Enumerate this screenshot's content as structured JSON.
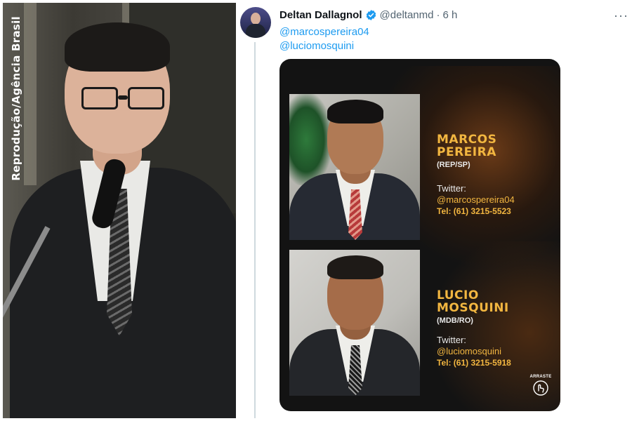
{
  "photo_credit": "Reprodução/Agência Brasil",
  "tweet": {
    "author_name": "Deltan Dallagnol",
    "author_handle": "@deltanmd",
    "separator": "·",
    "time": "6 h",
    "mentions": [
      "@marcospereira04",
      "@luciomosquini"
    ],
    "more_icon": "more-horizontal-icon",
    "verified_icon": "verified-badge-icon",
    "accent_color": "#1d9bf0"
  },
  "card": {
    "people": [
      {
        "name_line1": "MARCOS",
        "name_line2": "PEREIRA",
        "party": "(REP/SP)",
        "twitter_label": "Twitter:",
        "twitter_handle": "@marcospereira04",
        "tel": "Tel: (61) 3215-5523"
      },
      {
        "name_line1": "LUCIO",
        "name_line2": "MOSQUINI",
        "party": "(MDB/RO)",
        "twitter_label": "Twitter:",
        "twitter_handle": "@luciomosquini",
        "tel": "Tel: (61) 3215-5918"
      }
    ],
    "swipe_label": "ARRASTE",
    "highlight_color": "#f2b640"
  }
}
